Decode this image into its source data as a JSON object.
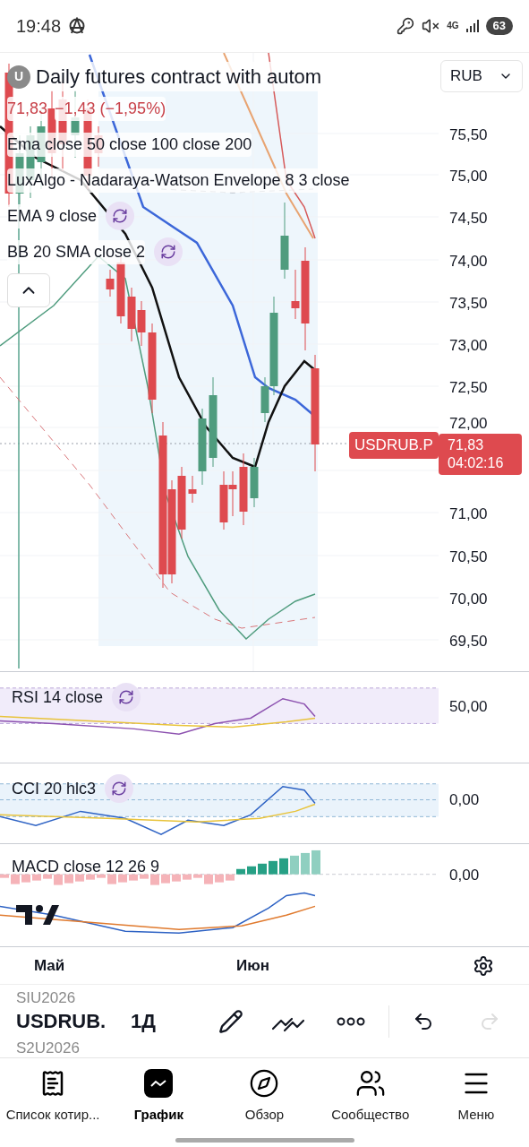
{
  "status_bar": {
    "time": "19:48",
    "network": "4G",
    "battery": "63"
  },
  "header": {
    "badge": "U",
    "title": "Daily futures contract with autom",
    "price": "71,83",
    "change": "−1,43 (−1,95%)",
    "currency": "RUB"
  },
  "legend": [
    {
      "label": "Ema close 50 close 100 close 200",
      "refresh": false
    },
    {
      "label": "LuxAlgo - Nadaraya-Watson Envelope 8 3 close",
      "refresh": false
    },
    {
      "label": "EMA 9 close",
      "refresh": true
    },
    {
      "label": "BB 20 SMA close 2",
      "refresh": true
    }
  ],
  "price_axis": [
    "75,50",
    "75,00",
    "74,50",
    "74,00",
    "73,50",
    "73,00",
    "72,50",
    "72,00",
    "71,00",
    "70,50",
    "70,00",
    "69,50"
  ],
  "price_tag": {
    "symbol": "USDRUB.P",
    "price": "71,83",
    "countdown": "04:02:16"
  },
  "panes": [
    {
      "kind": "rsi",
      "label": "RSI 14 close",
      "value": "50,00",
      "refresh": true
    },
    {
      "kind": "cci",
      "label": "CCI 20 hlc3",
      "value": "0,00",
      "refresh": true
    },
    {
      "kind": "macd",
      "label": "MACD close 12 26 9",
      "value": "0,00",
      "refresh": false
    }
  ],
  "time_axis": [
    "Май",
    "Июн"
  ],
  "toolbar": {
    "prev_symbol": "SIU2026",
    "symbol": "USDRUB.",
    "next_symbol": "S2U2026",
    "interval": "1Д"
  },
  "nav": [
    {
      "kind": "watchlist",
      "label": "Список котир...",
      "selected": false
    },
    {
      "kind": "chart",
      "label": "График",
      "selected": true
    },
    {
      "kind": "explore",
      "label": "Обзор",
      "selected": false
    },
    {
      "kind": "community",
      "label": "Сообщество",
      "selected": false
    },
    {
      "kind": "menu",
      "label": "Меню",
      "selected": false
    }
  ]
}
